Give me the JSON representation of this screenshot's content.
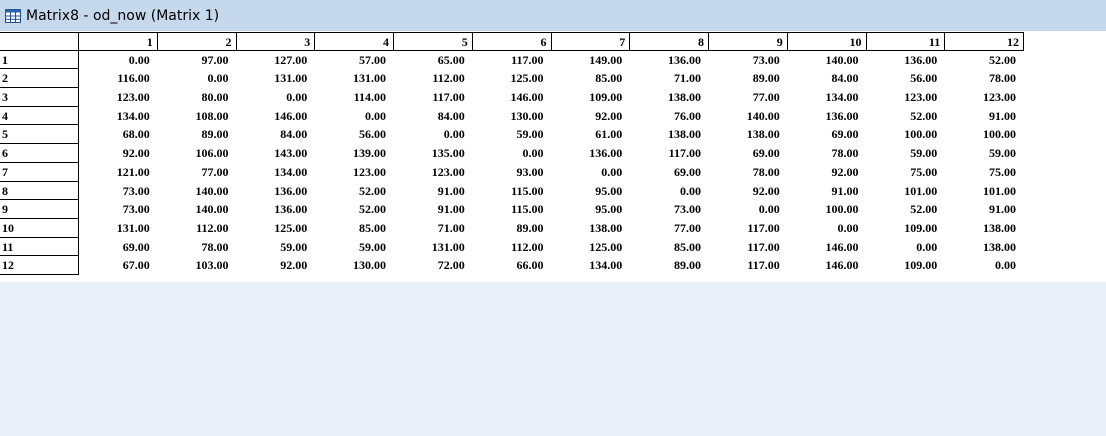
{
  "window": {
    "title": "Matrix8 - od_now (Matrix 1)",
    "icon": "matrix-table-icon"
  },
  "matrix": {
    "columns": [
      "1",
      "2",
      "3",
      "4",
      "5",
      "6",
      "7",
      "8",
      "9",
      "10",
      "11",
      "12"
    ],
    "rows": [
      {
        "label": "1",
        "values": [
          "0.00",
          "97.00",
          "127.00",
          "57.00",
          "65.00",
          "117.00",
          "149.00",
          "136.00",
          "73.00",
          "140.00",
          "136.00",
          "52.00"
        ]
      },
      {
        "label": "2",
        "values": [
          "116.00",
          "0.00",
          "131.00",
          "131.00",
          "112.00",
          "125.00",
          "85.00",
          "71.00",
          "89.00",
          "84.00",
          "56.00",
          "78.00"
        ]
      },
      {
        "label": "3",
        "values": [
          "123.00",
          "80.00",
          "0.00",
          "114.00",
          "117.00",
          "146.00",
          "109.00",
          "138.00",
          "77.00",
          "134.00",
          "123.00",
          "123.00"
        ]
      },
      {
        "label": "4",
        "values": [
          "134.00",
          "108.00",
          "146.00",
          "0.00",
          "84.00",
          "130.00",
          "92.00",
          "76.00",
          "140.00",
          "136.00",
          "52.00",
          "91.00"
        ]
      },
      {
        "label": "5",
        "values": [
          "68.00",
          "89.00",
          "84.00",
          "56.00",
          "0.00",
          "59.00",
          "61.00",
          "138.00",
          "138.00",
          "69.00",
          "100.00",
          "100.00"
        ]
      },
      {
        "label": "6",
        "values": [
          "92.00",
          "106.00",
          "143.00",
          "139.00",
          "135.00",
          "0.00",
          "136.00",
          "117.00",
          "69.00",
          "78.00",
          "59.00",
          "59.00"
        ]
      },
      {
        "label": "7",
        "values": [
          "121.00",
          "77.00",
          "134.00",
          "123.00",
          "123.00",
          "93.00",
          "0.00",
          "69.00",
          "78.00",
          "92.00",
          "75.00",
          "75.00"
        ]
      },
      {
        "label": "8",
        "values": [
          "73.00",
          "140.00",
          "136.00",
          "52.00",
          "91.00",
          "115.00",
          "95.00",
          "0.00",
          "92.00",
          "91.00",
          "101.00",
          "101.00"
        ]
      },
      {
        "label": "9",
        "values": [
          "73.00",
          "140.00",
          "136.00",
          "52.00",
          "91.00",
          "115.00",
          "95.00",
          "73.00",
          "0.00",
          "100.00",
          "52.00",
          "91.00"
        ]
      },
      {
        "label": "10",
        "values": [
          "131.00",
          "112.00",
          "125.00",
          "85.00",
          "71.00",
          "89.00",
          "138.00",
          "77.00",
          "117.00",
          "0.00",
          "109.00",
          "138.00"
        ]
      },
      {
        "label": "11",
        "values": [
          "69.00",
          "78.00",
          "59.00",
          "59.00",
          "131.00",
          "112.00",
          "125.00",
          "85.00",
          "117.00",
          "146.00",
          "0.00",
          "138.00"
        ]
      },
      {
        "label": "12",
        "values": [
          "67.00",
          "103.00",
          "92.00",
          "130.00",
          "72.00",
          "66.00",
          "134.00",
          "89.00",
          "117.00",
          "146.00",
          "109.00",
          "0.00"
        ]
      }
    ]
  }
}
